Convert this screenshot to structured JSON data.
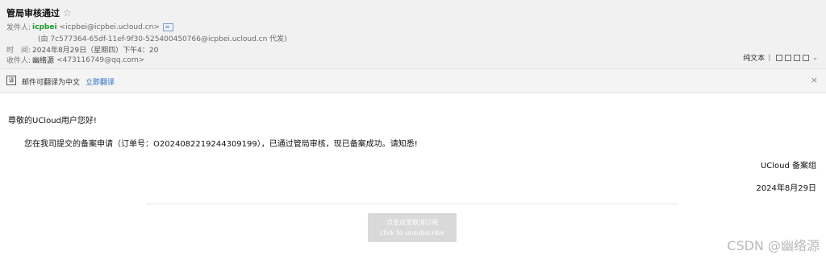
{
  "header": {
    "subject": "管局审核通过",
    "star": "☆",
    "sender_label": "发件人:",
    "sender_name": "icpbei",
    "sender_addr": "<icpbei@icpbei.ucloud.cn>",
    "proxy_line": "(由 7c577364-65df-11ef-9f30-525400450766@icpbei.ucloud.cn 代发)",
    "time_label": "时　间:",
    "time_value": "2024年8月29日（星期四）下午4：20",
    "recipient_label": "收件人:",
    "recipient_name": "幽络源",
    "recipient_addr": "<473116749@qq.com>"
  },
  "toolbar": {
    "plain_text": "纯文本",
    "separator": "|",
    "chevron": "⌄"
  },
  "translate": {
    "icon_char": "译",
    "text": "邮件可翻译为中文",
    "link": "立即翻译",
    "close": "×"
  },
  "body": {
    "greeting": "尊敬的UCloud用户您好!",
    "paragraph": "您在我司提交的备案申请（订单号：O2024082219244309199），已通过管局审核，现已备案成功。请知悉!",
    "signature": "UCloud 备案组",
    "date": "2024年8月29日"
  },
  "unsubscribe": {
    "line1": "点击这里取消订阅",
    "line2": "click to unsubscribe"
  },
  "watermark": "CSDN @幽络源"
}
